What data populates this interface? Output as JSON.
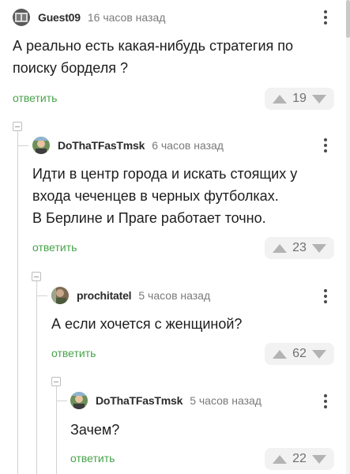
{
  "comments": [
    {
      "author": "Guest09",
      "time": "16 часов назад",
      "text": "А реально есть какая-нибудь стратегия по\nпоиску борделя ?",
      "reply_label": "ответить",
      "score": "19"
    },
    {
      "author": "DoThaTFasTmsk",
      "time": "6 часов назад",
      "text": "Идти в центр города и искать стоящих у\nвхода чеченцев в черных футболках.\nВ Берлине и Праге работает точно.",
      "reply_label": "ответить",
      "score": "23"
    },
    {
      "author": "prochitatel",
      "time": "5 часов назад",
      "text": "А если хочется с женщиной?",
      "reply_label": "ответить",
      "score": "62"
    },
    {
      "author": "DoThaTFasTmsk",
      "time": "5 часов назад",
      "text": "Зачем?",
      "reply_label": "ответить",
      "score": "22"
    }
  ],
  "icons": {
    "more": "more-vertical-icon",
    "upvote": "arrow-up-icon",
    "downvote": "arrow-down-icon",
    "collapse": "collapse-minus-icon"
  },
  "colors": {
    "reply": "#47a34a",
    "vote_bg": "#f2f2f2",
    "arrow": "#b3b3b3"
  }
}
